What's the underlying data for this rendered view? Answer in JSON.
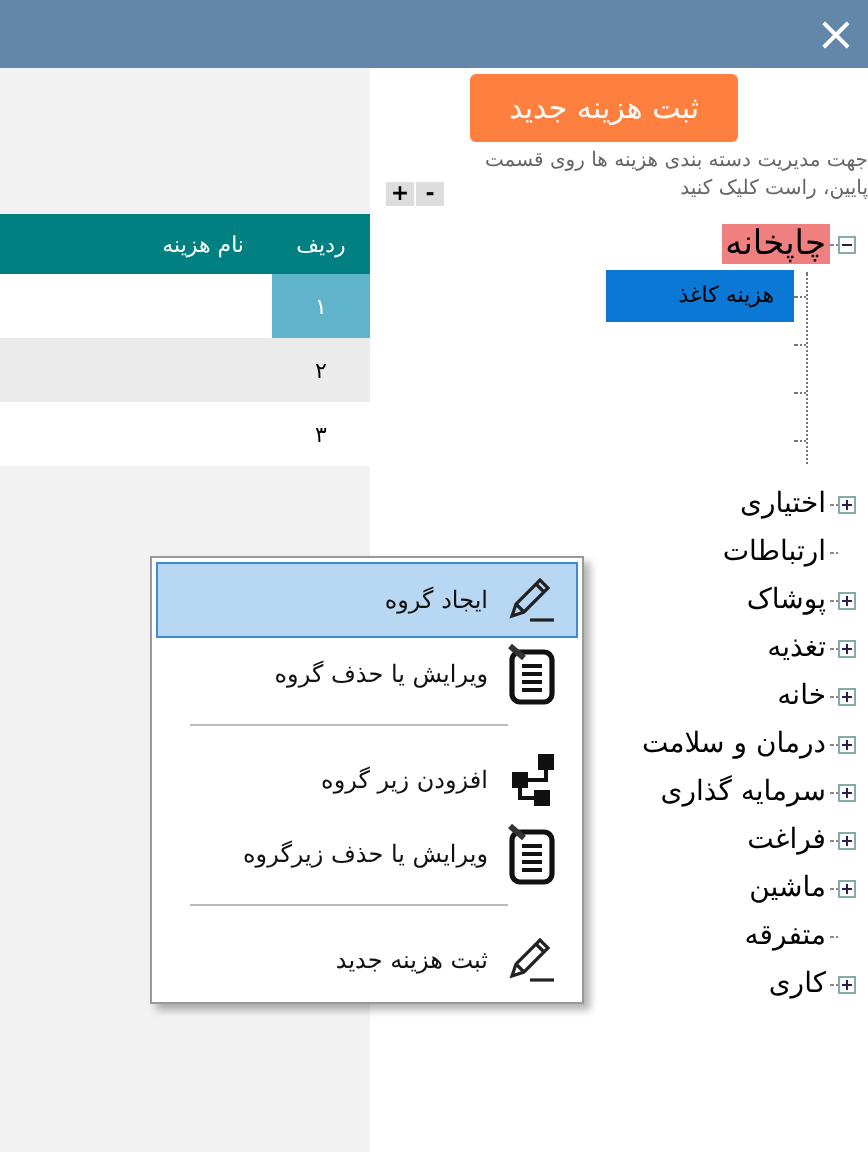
{
  "window": {
    "close": "×"
  },
  "table": {
    "columns": [
      "ردیف",
      "نام هزینه"
    ],
    "rows": [
      {
        "cells": [
          "۱"
        ],
        "selected": true
      },
      {
        "cells": [
          "۲"
        ],
        "selected": false
      },
      {
        "cells": [
          "۳"
        ],
        "selected": false
      }
    ]
  },
  "new_cost_button": "ثبت هزینه جدید",
  "hint": "جهت مدیریت دسته بندی هزینه ها روی قسمت پایین، راست کلیک کنید",
  "zoom_buttons": [
    "-",
    "+"
  ],
  "tree": [
    {
      "label": "چاپخانه",
      "kind": "folder",
      "expanded": true,
      "highlighted": true,
      "children": [
        {
          "label": "هزینه کاغذ",
          "kind": "leaf",
          "selected": true
        },
        {
          "kind": "blank"
        },
        {
          "kind": "blank"
        },
        {
          "kind": "blank"
        }
      ]
    },
    {
      "label": "اختیاری",
      "kind": "folder",
      "expanded": false,
      "highlighted": false
    },
    {
      "label": "ارتباطات",
      "kind": "leaf",
      "highlighted": false
    },
    {
      "label": "پوشاک",
      "kind": "folder",
      "expanded": false,
      "highlighted": false
    },
    {
      "label": "تغذیه",
      "kind": "folder",
      "expanded": false,
      "highlighted": false
    },
    {
      "label": "خانه",
      "kind": "folder",
      "expanded": false,
      "highlighted": false
    },
    {
      "label": "درمان و سلامت",
      "kind": "folder",
      "expanded": false,
      "highlighted": false
    },
    {
      "label": "سرمایه گذاری",
      "kind": "folder",
      "expanded": false,
      "highlighted": false
    },
    {
      "label": "فراغت",
      "kind": "folder",
      "expanded": false,
      "highlighted": false
    },
    {
      "label": "ماشین",
      "kind": "folder",
      "expanded": false,
      "highlighted": false
    },
    {
      "label": "متفرقه",
      "kind": "leaf",
      "highlighted": false
    },
    {
      "label": "کاری",
      "kind": "folder",
      "expanded": false,
      "highlighted": false
    }
  ],
  "context_menu": [
    {
      "label": "ایجاد گروه",
      "kind": "pencil",
      "selected": true,
      "separator_after": false
    },
    {
      "label": "ویرایش یا حذف گروه",
      "kind": "notepad",
      "selected": false,
      "separator_after": true
    },
    {
      "label": "افزودن زیر گروه",
      "kind": "hierarchy",
      "selected": false,
      "separator_after": false
    },
    {
      "label": "ویرایش یا حذف زیرگروه",
      "kind": "notepad",
      "selected": false,
      "separator_after": true
    },
    {
      "label": "ثبت هزینه جدید",
      "kind": "pencil",
      "selected": false,
      "separator_after": false
    }
  ]
}
